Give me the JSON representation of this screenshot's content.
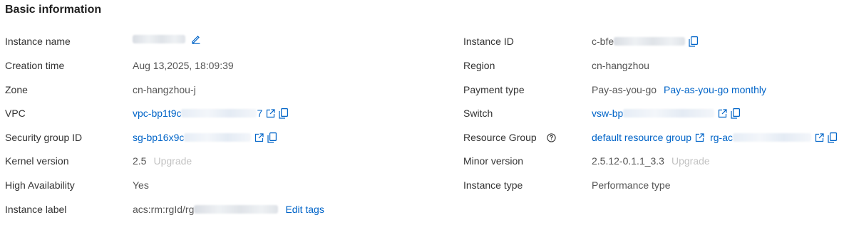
{
  "section": {
    "title": "Basic information"
  },
  "left": {
    "instance_name": {
      "label": "Instance name"
    },
    "creation_time": {
      "label": "Creation time",
      "value": "Aug 13,2025, 18:09:39"
    },
    "zone": {
      "label": "Zone",
      "value": "cn-hangzhou-j"
    },
    "vpc": {
      "label": "VPC",
      "value_prefix": "vpc-bp1t9c",
      "value_suffix": "7"
    },
    "security_group": {
      "label": "Security group ID",
      "value_prefix": "sg-bp16x9c"
    },
    "kernel_version": {
      "label": "Kernel version",
      "value": "2.5",
      "action": "Upgrade"
    },
    "high_availability": {
      "label": "High Availability",
      "value": "Yes"
    },
    "instance_label": {
      "label": "Instance label",
      "value_prefix": "acs:rm:rgId/rg",
      "action": "Edit tags"
    }
  },
  "right": {
    "instance_id": {
      "label": "Instance ID",
      "value_prefix": "c-bfe"
    },
    "region": {
      "label": "Region",
      "value": "cn-hangzhou"
    },
    "payment_type": {
      "label": "Payment type",
      "value": "Pay-as-you-go",
      "action": "Pay-as-you-go monthly"
    },
    "switch": {
      "label": "Switch",
      "value_prefix": "vsw-bp"
    },
    "resource_group": {
      "label": "Resource Group",
      "value": "default resource group",
      "id_prefix": "rg-ac"
    },
    "minor_version": {
      "label": "Minor version",
      "value": "2.5.12-0.1.1_3.3",
      "action": "Upgrade"
    },
    "instance_type": {
      "label": "Instance type",
      "value": "Performance type"
    }
  },
  "colors": {
    "link": "#0064c8",
    "label": "#333333",
    "muted": "#c2c2c2"
  },
  "icons": [
    "edit-icon",
    "external-link-icon",
    "copy-icon",
    "help-icon"
  ]
}
